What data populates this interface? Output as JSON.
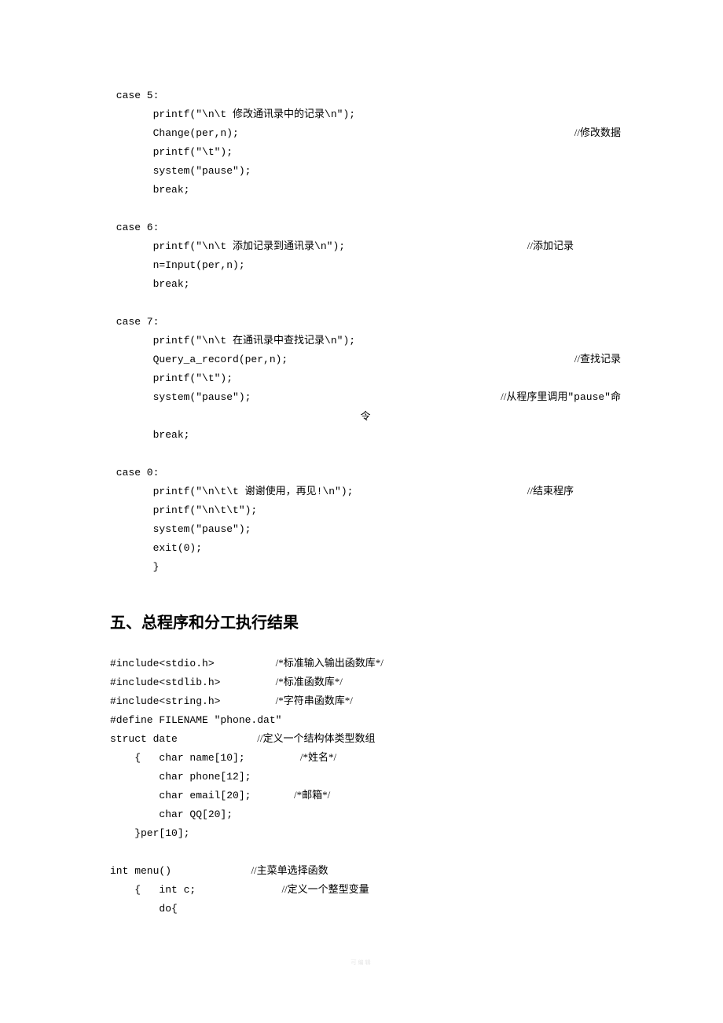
{
  "case5": {
    "header": " case 5:",
    "l1_code": "       printf(\"\\n\\t ",
    "l1_text": "修改通讯录中的记录",
    "l1_tail": "\\n\");",
    "l2_code": "       Change(per,n);",
    "l2_cmt": "//修改数据",
    "l3": "       printf(\"\\t\");",
    "l4": "       system(\"pause\");",
    "l5": "       break;"
  },
  "case6": {
    "header": " case 6:",
    "l1_code": "       printf(\"\\n\\t ",
    "l1_text": "添加记录到通讯录",
    "l1_tail": "\\n\");",
    "l1_cmt": "//添加记录",
    "l2": "       n=Input(per,n);",
    "l3": "       break;"
  },
  "case7": {
    "header": " case 7:",
    "l1_code": "       printf(\"\\n\\t ",
    "l1_text": "在通讯录中查找记录",
    "l1_tail": "\\n\");",
    "l2_code": "       Query_a_record(per,n);",
    "l2_cmt": "//查找记录",
    "l3": "       printf(\"\\t\");",
    "l4_code": "       system(\"pause\");",
    "l4_cmt_pre": "//从程序里调用",
    "l4_cmt_mono": "\"pause\"",
    "l4_cmt_post": "命",
    "l4_center": "令",
    "l5": "       break;"
  },
  "case0": {
    "header": " case 0:",
    "l1_code": "       printf(\"\\n\\t\\t ",
    "l1_text": "谢谢使用，再见",
    "l1_tail": "!\\n\");",
    "l1_cmt": "//结束程序",
    "l2": "       printf(\"\\n\\t\\t\");",
    "l3": "       system(\"pause\");",
    "l4": "       exit(0);",
    "l5": "       }"
  },
  "heading": "五、总程序和分工执行结果",
  "prog": {
    "l1_code": "#include<stdio.h>          ",
    "l1_cmt": "/*标准输入输出函数库*/",
    "l2_code": "#include<stdlib.h>         ",
    "l2_cmt": "/*标准函数库*/",
    "l3_code": "#include<string.h>         ",
    "l3_cmt": "/*字符串函数库*/",
    "l4": "#define FILENAME \"phone.dat\"",
    "l5_code": "struct date             ",
    "l5_cmt": "//定义一个结构体类型数组",
    "l6_code": "    {   char name[10];         ",
    "l6_cmt": "/*姓名*/",
    "l7": "        char phone[12];",
    "l8_code": "        char email[20];       ",
    "l8_cmt": "/*邮箱*/",
    "l9": "        char QQ[20];",
    "l10": "    }per[10];",
    "l11_code": "int menu()             ",
    "l11_cmt": "//主菜单选择函数",
    "l12_code": "    {   int c;              ",
    "l12_cmt": "//定义一个整型变量",
    "l13": "        do{"
  },
  "footer": "可编辑"
}
